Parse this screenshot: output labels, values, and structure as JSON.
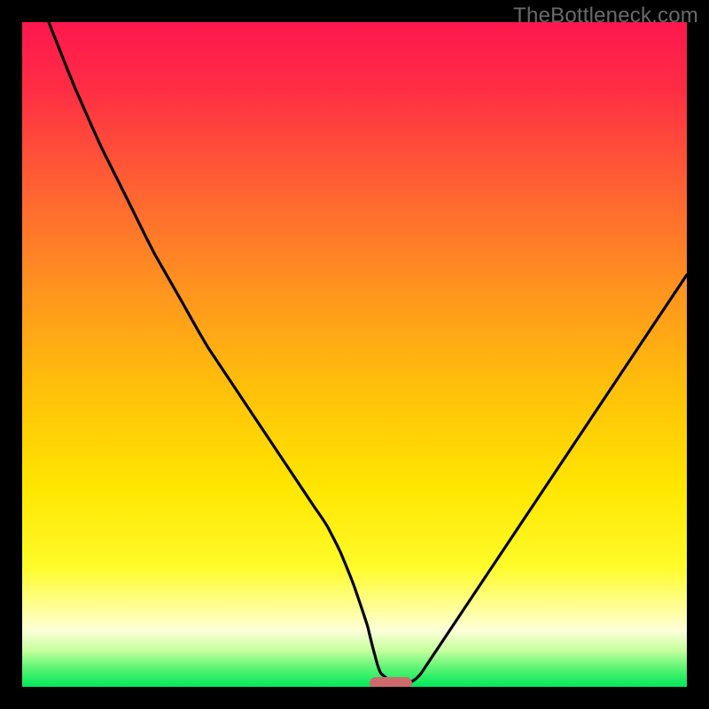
{
  "watermark": "TheBottleneck.com",
  "colors": {
    "frame": "#000000",
    "gradient_stops": [
      {
        "offset": 0.0,
        "color": "#ff174e"
      },
      {
        "offset": 0.1,
        "color": "#ff2d44"
      },
      {
        "offset": 0.25,
        "color": "#ff6232"
      },
      {
        "offset": 0.4,
        "color": "#ff931f"
      },
      {
        "offset": 0.55,
        "color": "#ffc00a"
      },
      {
        "offset": 0.7,
        "color": "#ffe600"
      },
      {
        "offset": 0.82,
        "color": "#fffb2a"
      },
      {
        "offset": 0.88,
        "color": "#ffff96"
      },
      {
        "offset": 0.915,
        "color": "#fdffd8"
      },
      {
        "offset": 0.945,
        "color": "#c7ff9e"
      },
      {
        "offset": 0.97,
        "color": "#62f576"
      },
      {
        "offset": 1.0,
        "color": "#00e85a"
      }
    ],
    "curve": "#000000",
    "marker": "#cd6a6c"
  },
  "chart_data": {
    "type": "line",
    "title": "",
    "xlabel": "",
    "ylabel": "",
    "xlim": [
      0,
      100
    ],
    "ylim": [
      0,
      100
    ],
    "grid": false,
    "series": [
      {
        "name": "bottleneck-curve",
        "x": [
          4,
          8,
          12,
          16,
          20,
          24,
          28,
          32,
          36,
          40,
          44,
          46,
          48,
          50,
          52,
          53,
          54,
          56,
          58,
          60,
          64,
          68,
          72,
          76,
          80,
          84,
          88,
          92,
          96,
          100
        ],
        "y": [
          100,
          90,
          81,
          73,
          65,
          58,
          51,
          45,
          39,
          33,
          27,
          24,
          20,
          15,
          9,
          5,
          2,
          0.5,
          0.5,
          2,
          8,
          14,
          20,
          26,
          32,
          38,
          44,
          50,
          56,
          62
        ]
      }
    ],
    "annotations": [
      {
        "name": "optimum-marker",
        "x": 55.5,
        "y": 0.5
      }
    ]
  }
}
